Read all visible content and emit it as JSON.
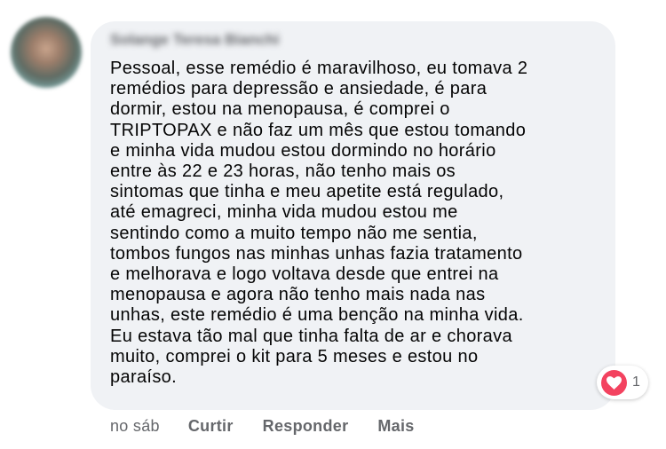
{
  "comment": {
    "author": "Solange Teresa Bianchi",
    "lines": [
      "Pessoal, esse remédio é maravilhoso, eu tomava 2",
      "remédios para depressão e ansiedade, é para",
      "dormir, estou na menopausa, é comprei o",
      "TRIPTOPAX e não faz um mês que estou tomando",
      "e minha vida mudou estou dormindo no horário",
      "entre às 22 e 23 horas, não tenho mais os",
      "sintomas que tinha e meu apetite está regulado,",
      "até emagreci, minha vida mudou estou me",
      "sentindo como a muito tempo não me sentia,",
      "tombos fungos nas minhas unhas fazia tratamento",
      "e melhorava e logo voltava desde que entrei na",
      "menopausa e agora não tenho mais nada nas",
      "unhas, este remédio é uma benção na minha vida.",
      "Eu estava tão mal que tinha falta de ar e chorava",
      "muito, comprei o kit para 5 meses e estou no",
      "paraíso."
    ]
  },
  "reactions": {
    "icon": "heart-icon",
    "count": "1",
    "color": "#f3425f"
  },
  "actions": {
    "time": "no sáb",
    "like": "Curtir",
    "reply": "Responder",
    "more": "Mais"
  }
}
